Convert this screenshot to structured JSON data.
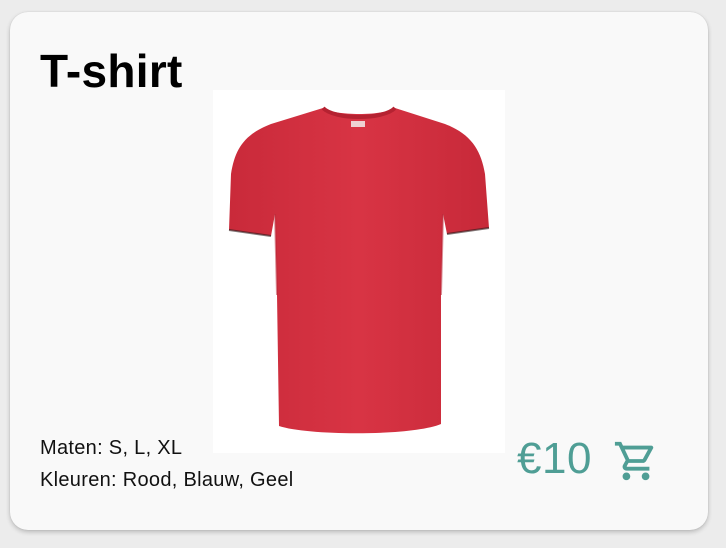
{
  "product": {
    "title": "T-shirt",
    "sizes_label": "Maten: S, L, XL",
    "colors_label": "Kleuren: Rood, Blauw, Geel",
    "price": "€10",
    "shirt_color": "#d22f3f",
    "accent_color": "#4f9e95"
  },
  "icons": {
    "cart": "shopping-cart-icon"
  }
}
